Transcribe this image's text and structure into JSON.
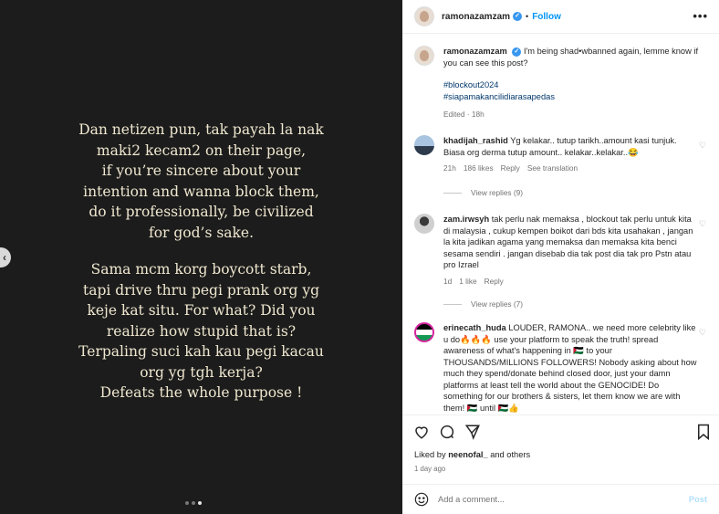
{
  "media": {
    "paragraph1": "Dan netizen pun, tak payah la nak\nmaki2 kecam2 on their page,\nif you’re sincere about your\nintention and wanna block them,\ndo it professionally, be civilized\nfor god’s sake.",
    "paragraph2": "Sama mcm korg boycott starb,\ntapi drive thru pegi prank org yg\nkeje kat situ. For what? Did you\nrealize how stupid that is?\nTerpaling suci kah kau pegi kacau\norg yg tgh kerja?\nDefeats the whole purpose !",
    "carousel_dots": 3,
    "active_dot": 2
  },
  "header": {
    "username": "ramonazamzam",
    "separator": "•",
    "follow_label": "Follow",
    "more_label": "•••"
  },
  "caption": {
    "username": "ramonazamzam",
    "text": "I'm being shad•wbanned again, lemme know if you can see this post?",
    "hashtag1": "#blockout2024",
    "hashtag2": "#siapamakancilidiarasapedas",
    "meta": "Edited · 18h"
  },
  "comments": [
    {
      "username": "khadijah_rashid",
      "text": "Yg kelakar.. tutup tarikh..amount kasi tunjuk. Biasa org derma tutup amount.. kelakar..kelakar..😂",
      "time": "21h",
      "likes": "186 likes",
      "reply": "Reply",
      "extra": "See translation",
      "view_replies": "View replies (9)"
    },
    {
      "username": "zam.irwsyh",
      "text": "tak perlu nak memaksa , blockout tak perlu untuk kita di malaysia , cukup kempen boikot dari bds kita usahakan , jangan la kita jadikan agama yang memaksa dan memaksa kita benci sesama sendiri . jangan disebab dia tak post dia tak pro Pstn atau pro Izrael",
      "time": "1d",
      "likes": "1 like",
      "reply": "Reply",
      "view_replies": "View replies (7)"
    },
    {
      "username": "erinecath_huda",
      "text": "LOUDER, RAMONA.. we need more celebrity like u do🔥🔥🔥 use your platform to speak the truth! spread awareness of what's happening in 🇵🇸 to your THOUSANDS/MILLIONS FOLLOWERS! Nobody asking about how much they spend/donate behind closed door, just your damn platforms at least tell the world about the GENOCIDE! Do something for our brothers & sisters, let them know we are with them! 🇵🇸 until 🇵🇸👍"
    }
  ],
  "footer": {
    "likes_prefix": "Liked by ",
    "likes_user": "neenofal_",
    "likes_suffix": " and others",
    "time_ago": "1 day ago",
    "add_comment_placeholder": "Add a comment...",
    "post_label": "Post"
  },
  "colors": {
    "media_bg": "#1c1c1c",
    "media_text": "#efe7cf",
    "link_blue": "#0095f6",
    "hashtag": "#00376b",
    "muted": "#737373"
  }
}
